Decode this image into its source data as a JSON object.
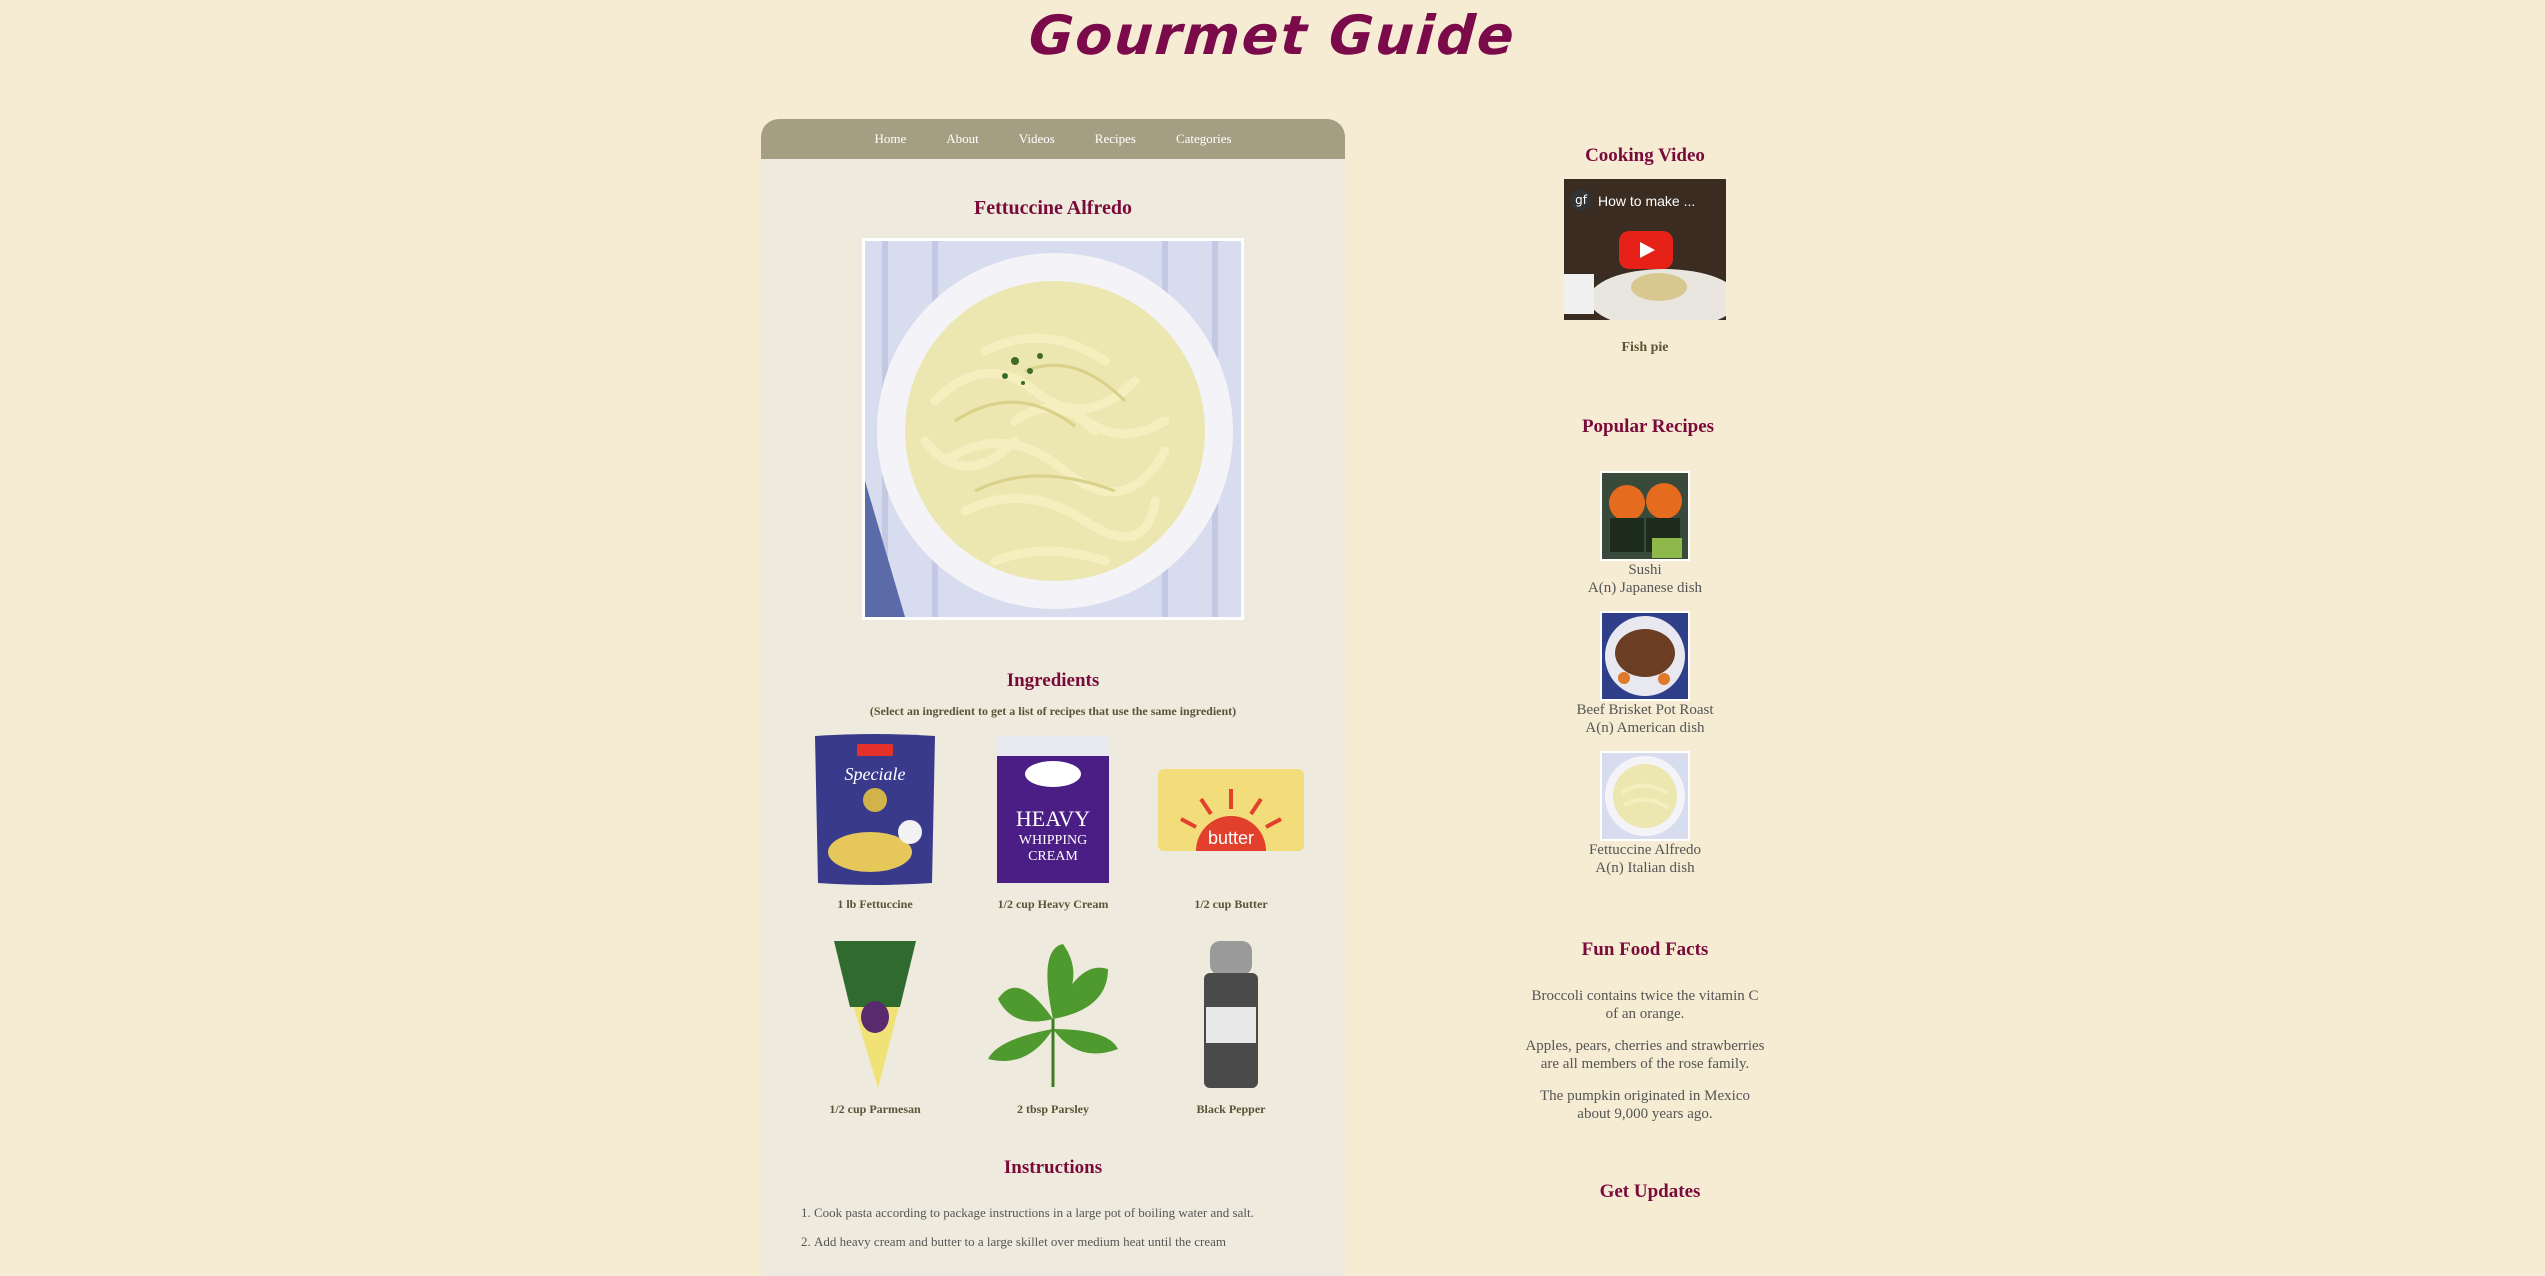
{
  "site": {
    "title": "Gourmet Guide"
  },
  "nav": {
    "items": [
      "Home",
      "About",
      "Videos",
      "Recipes",
      "Categories"
    ]
  },
  "recipe": {
    "title": "Fettuccine Alfredo",
    "ingredients_heading": "Ingredients",
    "ingredients_hint": "(Select an ingredient to get a list of recipes that use the same ingredient)",
    "ingredients": [
      {
        "label": "1 lb Fettuccine",
        "icon": "fettuccine-package-icon"
      },
      {
        "label": "1/2 cup Heavy Cream",
        "icon": "heavy-cream-carton-icon"
      },
      {
        "label": "1/2 cup Butter",
        "icon": "butter-block-icon"
      },
      {
        "label": "1/2 cup Parmesan",
        "icon": "parmesan-wedge-icon"
      },
      {
        "label": "2 tbsp Parsley",
        "icon": "parsley-leaf-icon"
      },
      {
        "label": "Black Pepper",
        "icon": "pepper-grinder-icon"
      }
    ],
    "instructions_heading": "Instructions",
    "instructions": [
      "Cook pasta according to package instructions in a large pot of boiling water and salt.",
      "Add heavy cream and butter to a large skillet over medium heat until the cream"
    ]
  },
  "sidebar": {
    "video_heading": "Cooking Video",
    "video_overlay_title": "How to make ...",
    "video_badge": "gf",
    "video_caption": "Fish pie",
    "popular_heading": "Popular Recipes",
    "popular": [
      {
        "name": "Sushi",
        "desc": "A(n) Japanese dish"
      },
      {
        "name": "Beef Brisket Pot Roast",
        "desc": "A(n) American dish"
      },
      {
        "name": "Fettuccine Alfredo",
        "desc": "A(n) Italian dish"
      }
    ],
    "facts_heading": "Fun Food Facts",
    "facts": [
      "Broccoli contains twice the vitamin C of an orange.",
      "Apples, pears, cherries and strawberries are all members of the rose family.",
      "The pumpkin originated in Mexico about 9,000 years ago."
    ],
    "updates_heading": "Get Updates"
  },
  "colors": {
    "background": "#f6ecd4",
    "accent": "#7a0a3a",
    "nav_bar": "#a49f82",
    "content_panel": "#eeebde",
    "youtube_red": "#e62117"
  }
}
